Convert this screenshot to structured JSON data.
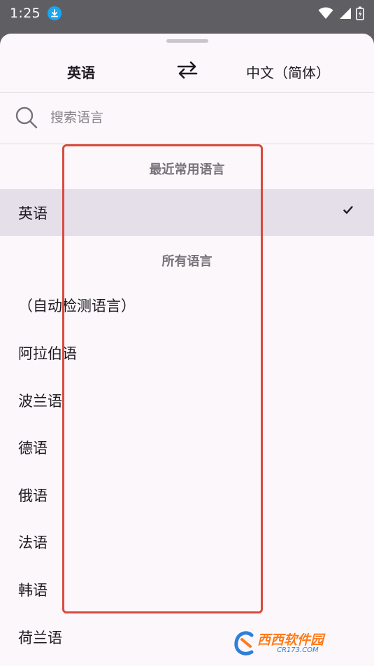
{
  "status_bar": {
    "time": "1:25"
  },
  "language_bar": {
    "source_language": "英语",
    "target_language": "中文（简体）"
  },
  "search": {
    "placeholder": "搜索语言"
  },
  "sections": {
    "recent_header": "最近常用语言",
    "all_header": "所有语言"
  },
  "recent_languages": [
    {
      "label": "英语",
      "selected": true
    }
  ],
  "all_languages": [
    {
      "label": "（自动检测语言）"
    },
    {
      "label": "阿拉伯语"
    },
    {
      "label": "波兰语"
    },
    {
      "label": "德语"
    },
    {
      "label": "俄语"
    },
    {
      "label": "法语"
    },
    {
      "label": "韩语"
    },
    {
      "label": "荷兰语"
    }
  ],
  "watermark": {
    "main": "西西软件园",
    "sub": "CR173.COM"
  },
  "colors": {
    "sheet_background": "#fbf7fb",
    "selected_row": "#e4dfe9",
    "annotation_border": "#d84a3c",
    "status_bar": "#5f5f63"
  }
}
